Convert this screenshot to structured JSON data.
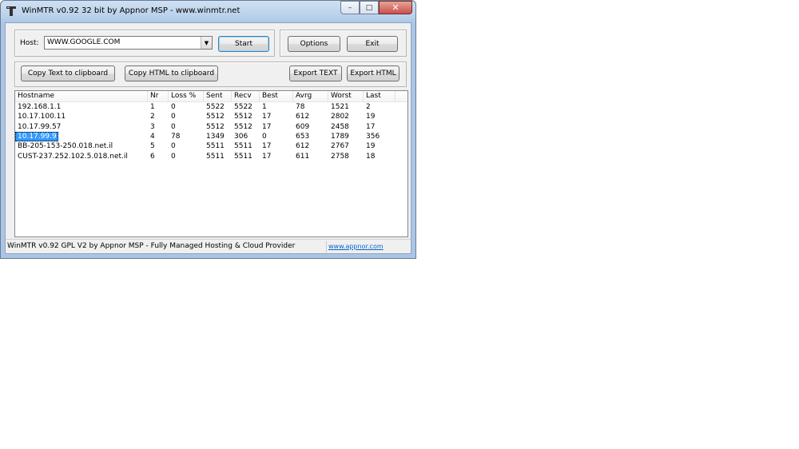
{
  "window": {
    "title": "WinMTR v0.92 32 bit by Appnor MSP - www.winmtr.net"
  },
  "caption": {
    "minimize": "–",
    "maximize": "□",
    "close": "✕"
  },
  "host": {
    "label": "Host:",
    "value": "WWW.GOOGLE.COM"
  },
  "buttons": {
    "start": "Start",
    "options": "Options",
    "exit": "Exit",
    "copy_text": "Copy Text to clipboard",
    "copy_html": "Copy HTML to clipboard",
    "export_text": "Export TEXT",
    "export_html": "Export HTML"
  },
  "table": {
    "columns": [
      "Hostname",
      "Nr",
      "Loss %",
      "Sent",
      "Recv",
      "Best",
      "Avrg",
      "Worst",
      "Last"
    ],
    "rows": [
      [
        "192.168.1.1",
        "1",
        "0",
        "5522",
        "5522",
        "1",
        "78",
        "1521",
        "2"
      ],
      [
        "10.17.100.11",
        "2",
        "0",
        "5512",
        "5512",
        "17",
        "612",
        "2802",
        "19"
      ],
      [
        "10.17.99.57",
        "3",
        "0",
        "5512",
        "5512",
        "17",
        "609",
        "2458",
        "17"
      ],
      [
        "10.17.99.9",
        "4",
        "78",
        "1349",
        "306",
        "0",
        "653",
        "1789",
        "356"
      ],
      [
        "BB-205-153-250.018.net.il",
        "5",
        "0",
        "5511",
        "5511",
        "17",
        "612",
        "2767",
        "19"
      ],
      [
        "CUST-237.252.102.5.018.net.il",
        "6",
        "0",
        "5511",
        "5511",
        "17",
        "611",
        "2758",
        "18"
      ]
    ],
    "selected_row": 3
  },
  "status": {
    "text": "WinMTR v0.92 GPL V2 by Appnor MSP - Fully Managed Hosting & Cloud Provider",
    "link": "www.appnor.com"
  }
}
